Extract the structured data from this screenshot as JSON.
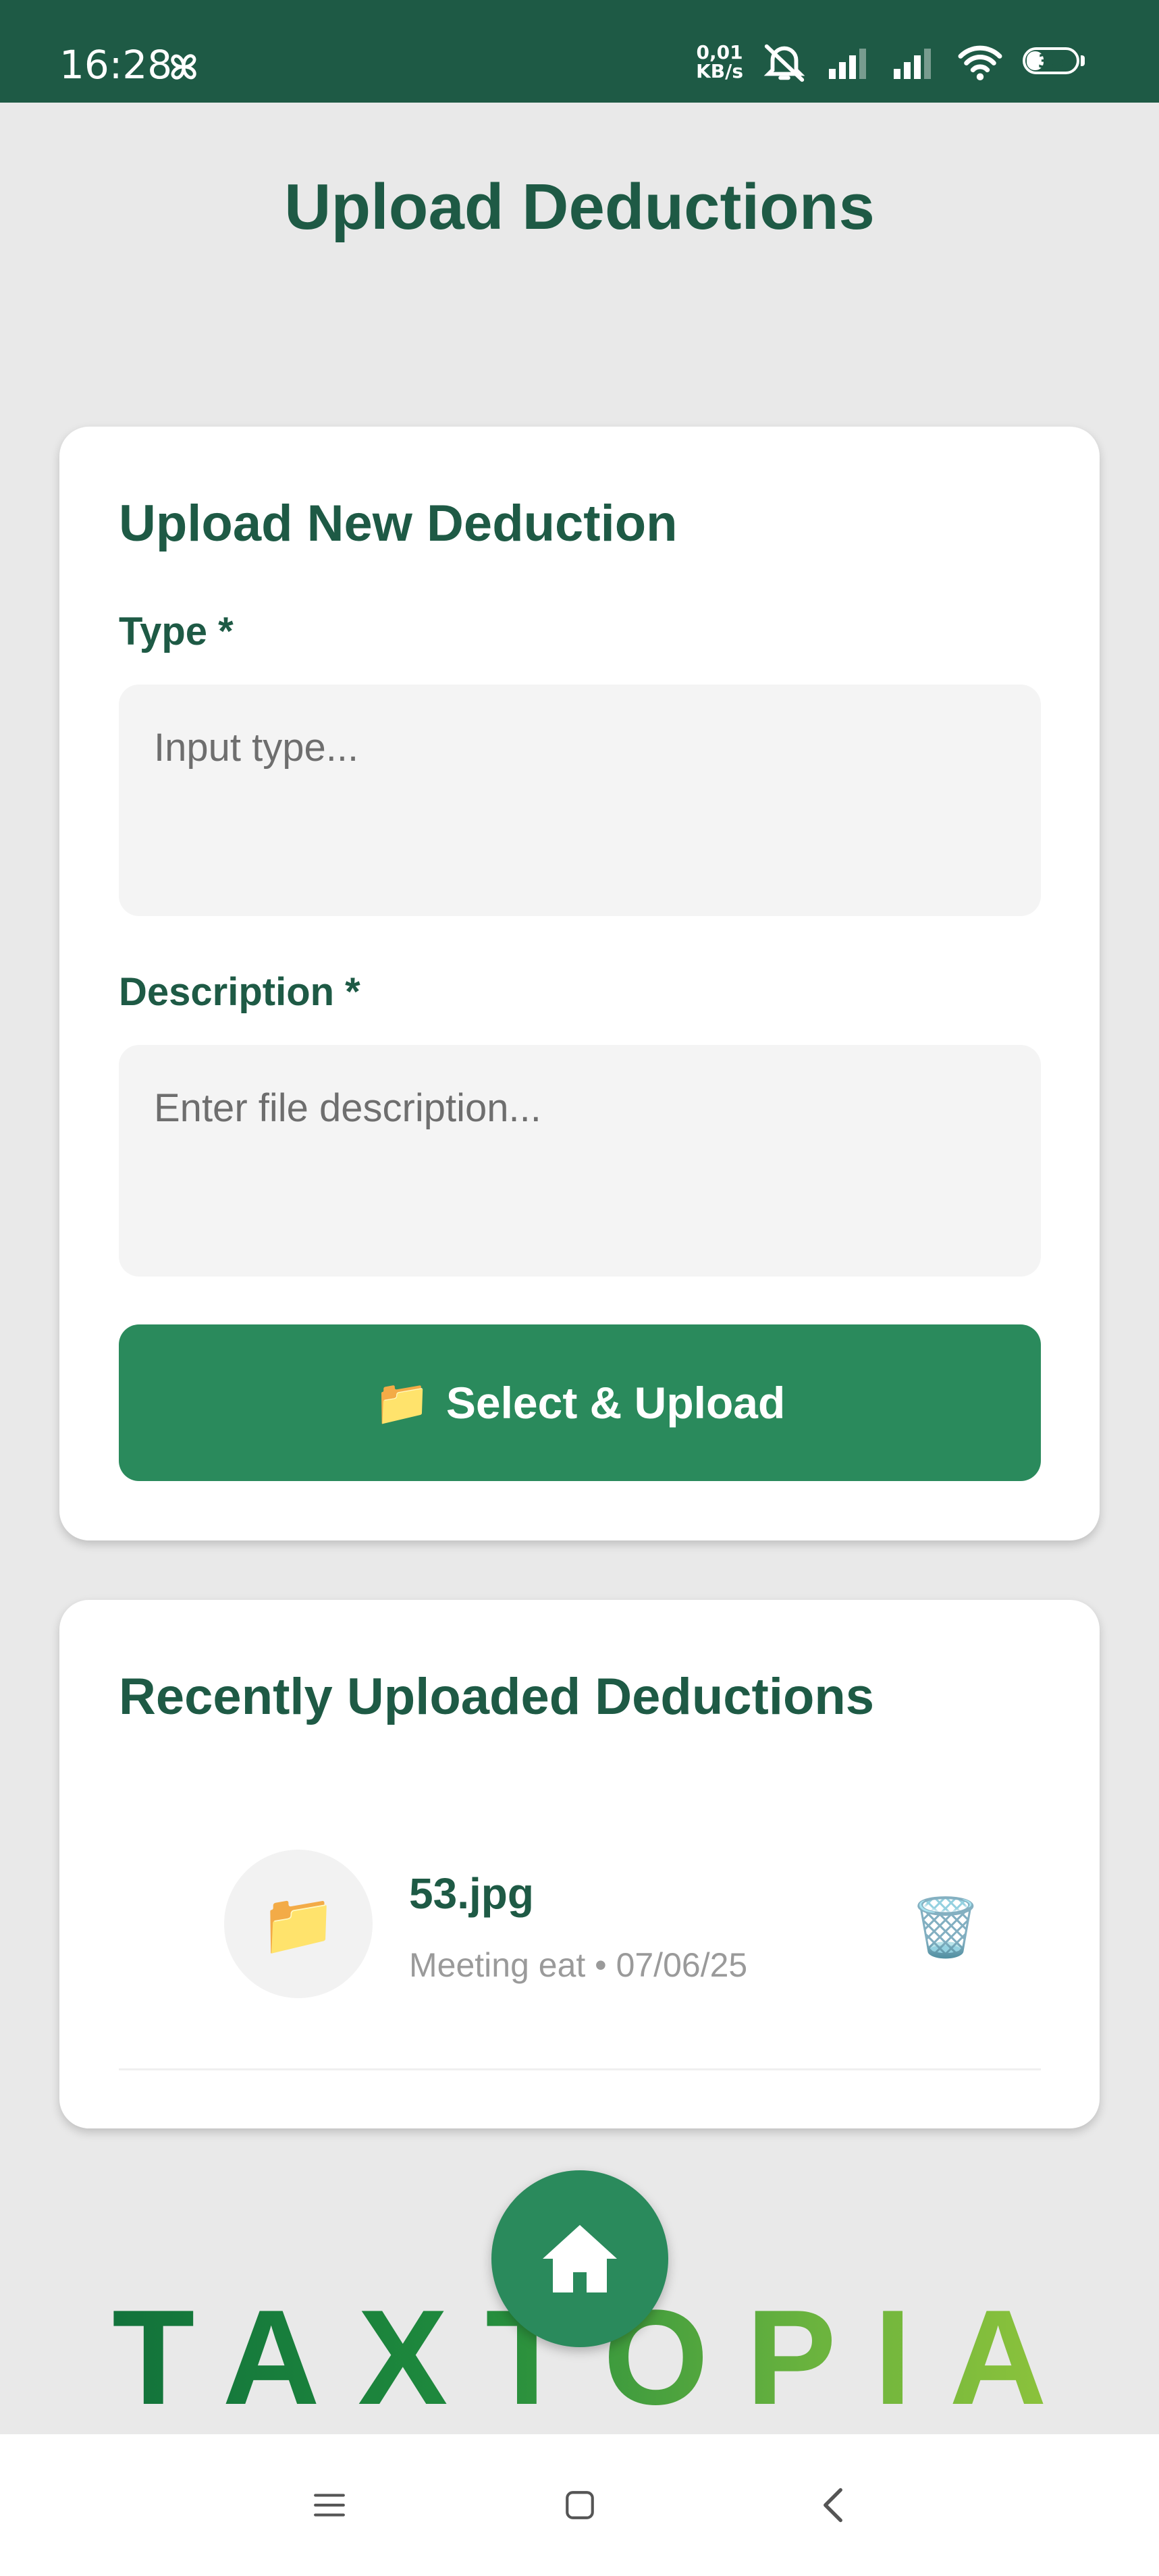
{
  "status_bar": {
    "time": "16:28",
    "net_speed_value": "0,01",
    "net_speed_unit": "KB/s",
    "battery": "35",
    "battery_level": 0.35,
    "icons": [
      "pinwheel-icon",
      "mute-icon",
      "signal-icon",
      "signal-icon",
      "wifi-icon",
      "battery-icon"
    ]
  },
  "page": {
    "title": "Upload Deductions"
  },
  "upload_card": {
    "title": "Upload New Deduction",
    "type_label": "Type *",
    "type_placeholder": "Input type...",
    "type_value": "",
    "description_label": "Description *",
    "description_placeholder": "Enter file description...",
    "description_value": "",
    "upload_icon": "📁",
    "upload_button_label": "Select & Upload"
  },
  "recent_card": {
    "title": "Recently Uploaded Deductions",
    "items": [
      {
        "icon": "📁",
        "file_name": "53.jpg",
        "meta": "Meeting eat • 07/06/25",
        "delete_icon": "🗑️"
      }
    ]
  },
  "brand": {
    "logo_text": "TAXTOPIA",
    "colors": {
      "primary_dark": "#1e5a45",
      "primary": "#2a8a5c",
      "logo_start": "#0e6b3a",
      "logo_end": "#9bc93a"
    }
  },
  "navigation": {
    "fab_icon": "home-icon",
    "system_buttons": [
      "menu-icon",
      "home-square-icon",
      "back-icon"
    ]
  }
}
